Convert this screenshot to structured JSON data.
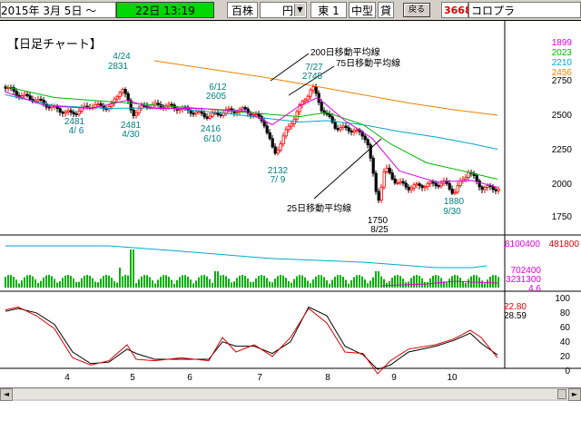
{
  "toolbar": {
    "date": "2015年  3月  5日  ～",
    "time": "22日 13:19",
    "unit": "百株",
    "currency": "円",
    "currency_dropdown": "▼",
    "market": "東 1",
    "size": "中型",
    "loan": "貸",
    "back_label": "戻る",
    "code": "3668",
    "name": "コロプラ"
  },
  "chart": {
    "title": "【日足チャート】",
    "ma_labels": {
      "ma200": "200日移動平均線",
      "ma75": "75日移動平均線",
      "ma25": "25日移動平均線"
    },
    "ma_values": [
      {
        "value": "1899",
        "color": "#e000e0"
      },
      {
        "value": "2023",
        "color": "#00b800"
      },
      {
        "value": "2210",
        "color": "#00a8c8"
      },
      {
        "value": "2456",
        "color": "#f08000"
      }
    ],
    "price_axis": [
      {
        "label": "2750",
        "value": 2750
      },
      {
        "label": "2500",
        "value": 2500
      },
      {
        "label": "2250",
        "value": 2250
      },
      {
        "label": "2000",
        "value": 2000
      },
      {
        "label": "1750",
        "value": 1750
      }
    ],
    "annotations": [
      {
        "id": "hi-0424",
        "price": "2831",
        "date": "4/24"
      },
      {
        "id": "lo-0406",
        "price": "2481",
        "date": "4/ 6"
      },
      {
        "id": "lo-0430",
        "price": "2481",
        "date": "4/30"
      },
      {
        "id": "hi-0612",
        "price": "2605",
        "date": "6/12"
      },
      {
        "id": "lo-0610",
        "price": "2416",
        "date": "6/10"
      },
      {
        "id": "lo-0709",
        "price": "2132",
        "date": "7/ 9"
      },
      {
        "id": "hi-0727",
        "price": "2745",
        "date": "7/27"
      },
      {
        "id": "lo-0825",
        "price": "1750",
        "date": "8/25"
      },
      {
        "id": "lo-0930",
        "price": "1880",
        "date": "9/30"
      }
    ],
    "volume_axis": {
      "top": "8100400",
      "top_red": "481800",
      "mid": "702400",
      "bottom": "3231300",
      "small": "4.6"
    },
    "osc_axis": [
      "100",
      "80",
      "60",
      "40",
      "20",
      "0"
    ],
    "osc_values": {
      "red": "22.80",
      "black": "28.59"
    },
    "months": [
      "4",
      "5",
      "6",
      "7",
      "8",
      "9",
      "10"
    ],
    "colors": {
      "up": "#ff0000",
      "down": "#000000",
      "ma25": "#e000e0",
      "ma75": "#00b800",
      "ma200_teal": "#00a8c8",
      "ma200_orange": "#f08000",
      "volume": "#00b000"
    }
  },
  "scrollbar": {
    "left_arrow": "◄",
    "right_arrow": "►"
  }
}
